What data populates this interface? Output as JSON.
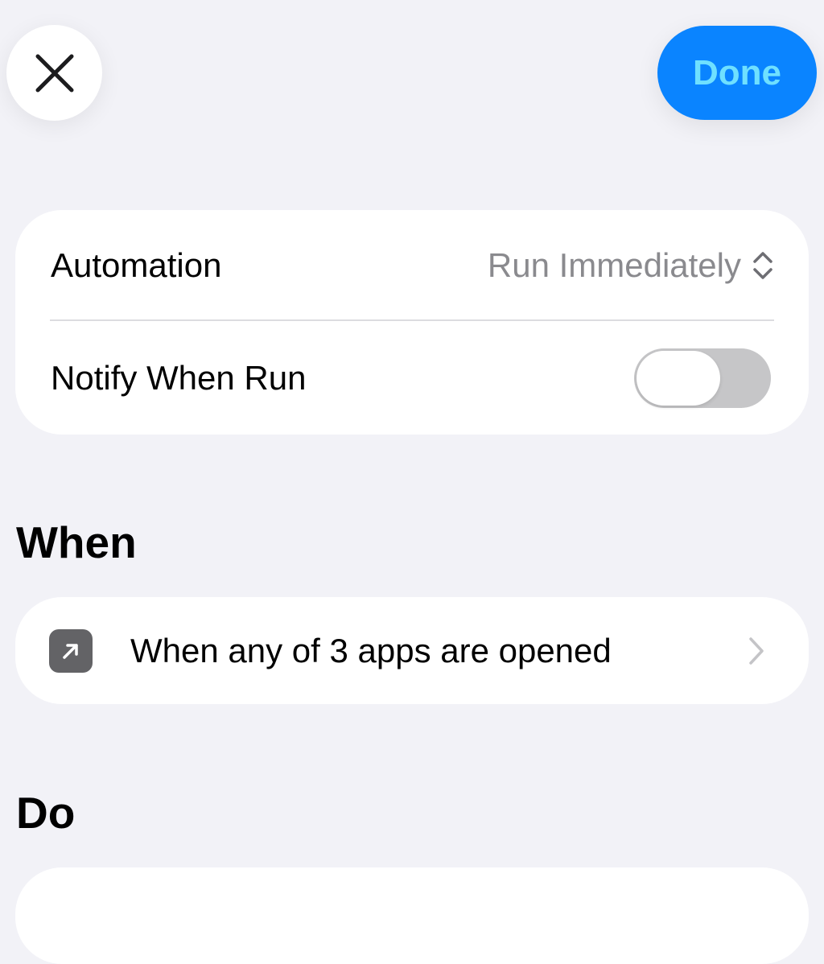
{
  "header": {
    "close_icon": "close-icon",
    "done_label": "Done"
  },
  "settings": {
    "automation": {
      "label": "Automation",
      "value": "Run Immediately",
      "icon": "up-down-chevron-icon"
    },
    "notify": {
      "label": "Notify When Run",
      "enabled": false
    }
  },
  "when_section": {
    "title": "When",
    "trigger": {
      "label": "When any of 3 apps are opened",
      "icon": "app-open-arrow-icon",
      "accessory": "chevron-right-icon"
    }
  },
  "do_section": {
    "title": "Do"
  },
  "colors": {
    "background": "#f2f2f7",
    "card": "#ffffff",
    "accent": "#0a84ff",
    "done_text": "#6fe0ff",
    "secondary_text": "#8a8a8e",
    "toggle_off": "#c6c6c8",
    "app_icon": "#636366"
  }
}
